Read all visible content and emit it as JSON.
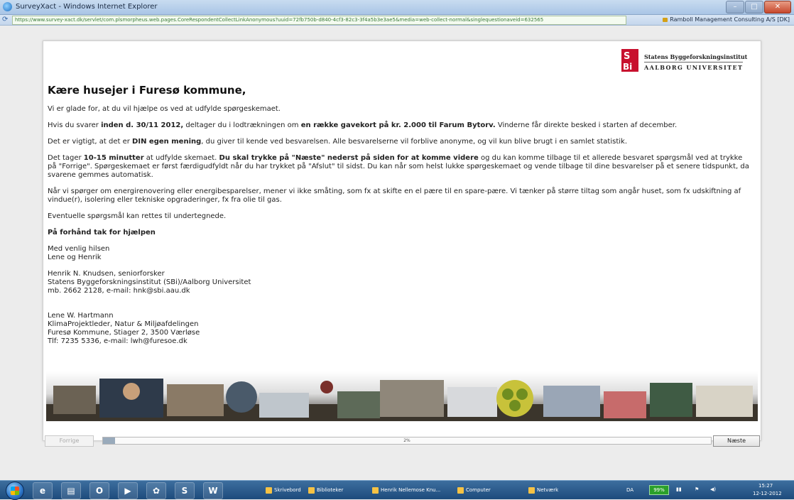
{
  "window": {
    "title": "SurveyXact - Windows Internet Explorer",
    "url": "https://www.survey-xact.dk/servlet/com.plsmorpheus.web.pages.CoreRespondentCollectLinkAnonymous?uuid=72fb750b-d840-4cf3-82c3-3f4a5b3e3ae5&media=web-collect-normal&singlequestionaveid=632565",
    "security_label": "Ramboll Management Consulting A/S [DK]",
    "controls": [
      "–",
      "□",
      "✕"
    ]
  },
  "logo": {
    "line1": "Statens Byggeforskningsinstitut",
    "line2": "AALBORG UNIVERSITET"
  },
  "content": {
    "heading": "Kære husejer i Furesø kommune,",
    "p1": "Vi er glade for, at du vil hjælpe os ved at udfylde spørgeskemaet.",
    "p2": {
      "a": "Hvis du svarer ",
      "b": "inden d. 30/11 2012,",
      "c": " deltager du i lodtrækningen om ",
      "d": "en række gavekort på kr. 2.000 til Farum Bytorv.",
      "e": " Vinderne får direkte besked i starten af december."
    },
    "p3": {
      "a": "Det er vigtigt, at det er ",
      "b": "DIN egen mening",
      "c": ", du giver til kende ved besvarelsen. Alle besvarelserne vil forblive anonyme, og vil kun blive brugt i en samlet statistik."
    },
    "p4": {
      "a": "Det tager ",
      "b": "10-15 minutter",
      "c": " at udfylde skemaet. ",
      "d": "Du skal trykke på \"Næste\" nederst på siden for at komme videre",
      "e": " og du kan komme tilbage til et allerede besvaret spørgsmål ved at trykke på \"Forrige\". Spørgeskemaet er først færdigudfyldt når du har trykket på \"Afslut\" til sidst. Du kan når som helst lukke spørgeskemaet og vende tilbage til dine besvarelser på et senere tidspunkt, da svarene gemmes automatisk."
    },
    "p5": "Når vi spørger om energirenovering eller energibesparelser, mener vi ikke småting, som fx at skifte en el pære til en spare-pære. Vi tænker på større tiltag som angår huset, som fx udskiftning af vindue(r), isolering eller tekniske opgraderinger, fx fra olie til gas.",
    "p6": "Eventuelle spørgsmål kan rettes til undertegnede.",
    "p7": "På forhånd tak for hjælpen",
    "greeting": [
      "Med venlig hilsen",
      "Lene og Henrik"
    ],
    "contact1": [
      "Henrik N. Knudsen, seniorforsker",
      "Statens Byggeforskningsinstitut (SBi)/Aalborg Universitet",
      "mb. 2662 2128, e-mail: hnk@sbi.aau.dk"
    ],
    "contact2": [
      "Lene W. Hartmann",
      "KlimaProjektleder, Natur & Miljøafdelingen",
      "Furesø Kommune, Stiager 2, 3500 Værløse",
      "Tlf: 7235 5336, e-mail: lwh@furesoe.dk"
    ]
  },
  "navigation": {
    "prev_label": "Forrige",
    "next_label": "Næste",
    "progress_label": "2%",
    "progress_value": 0.02
  },
  "taskbar": {
    "pinned": [
      "ie-icon",
      "explorer-icon",
      "outlook-icon",
      "windows-media-icon",
      "paint-icon",
      "skype-icon",
      "word-icon"
    ],
    "pinned_glyphs": [
      "e",
      "▤",
      "O",
      "▶",
      "✿",
      "S",
      "W"
    ],
    "items": [
      "Skrivebord",
      "Biblioteker",
      "Henrik Nellemose Knu...",
      "Computer",
      "Netværk"
    ],
    "tray": {
      "lang": "DA",
      "battery": "99%",
      "time": "15:27",
      "date": "12-12-2012"
    }
  }
}
